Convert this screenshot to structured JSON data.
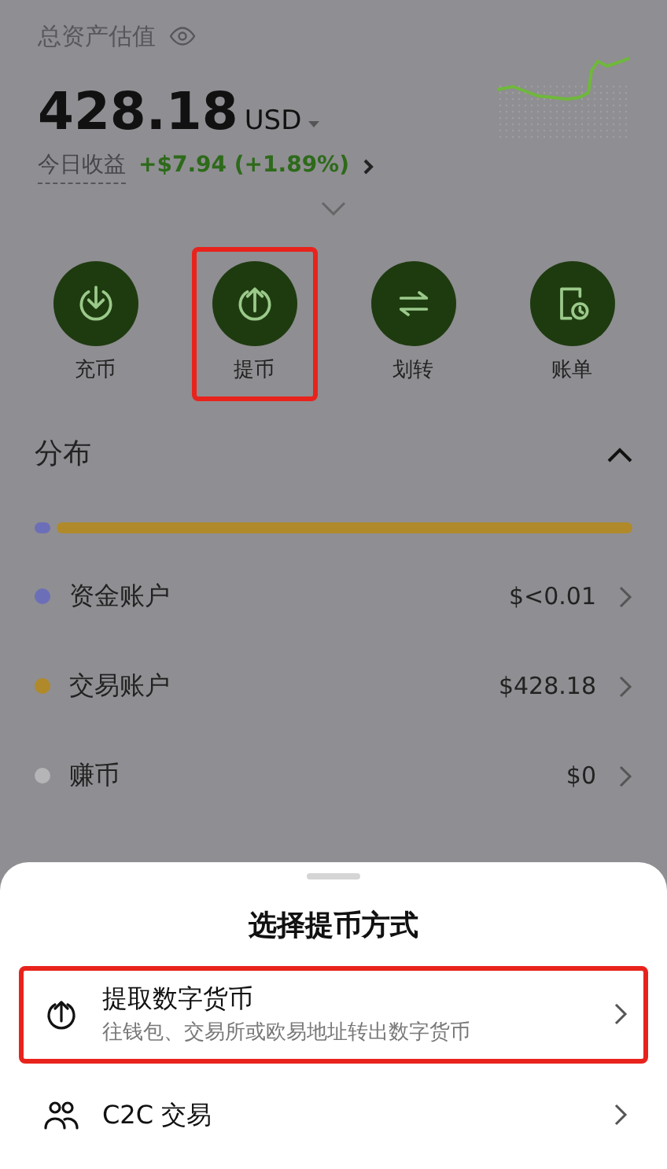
{
  "summary": {
    "label": "总资产估值",
    "amount": "428.18",
    "currency": "USD",
    "pnl_label": "今日收益",
    "pnl": "+$7.94 (+1.89%)"
  },
  "actions": [
    {
      "kind": "deposit",
      "label": "充币",
      "highlighted": false
    },
    {
      "kind": "withdraw",
      "label": "提币",
      "highlighted": true
    },
    {
      "kind": "transfer",
      "label": "划转",
      "highlighted": false
    },
    {
      "kind": "bill",
      "label": "账单",
      "highlighted": false
    }
  ],
  "distribution": {
    "title": "分布",
    "expanded": true,
    "accounts": [
      {
        "name": "资金账户",
        "value": "$<0.01",
        "color": "#6c6fb8",
        "in_bar": true
      },
      {
        "name": "交易账户",
        "value": "$428.18",
        "color": "#b08a2a",
        "in_bar": true
      },
      {
        "name": "赚币",
        "value": "$0",
        "color": "#b5b5b8",
        "in_bar": false
      }
    ]
  },
  "sheet": {
    "title": "选择提币方式",
    "options": [
      {
        "kind": "withdraw",
        "title": "提取数字货币",
        "subtitle": "往钱包、交易所或欧易地址转出数字货币",
        "highlighted": true
      },
      {
        "kind": "c2c",
        "title": "C2C 交易",
        "highlighted": false
      }
    ]
  }
}
